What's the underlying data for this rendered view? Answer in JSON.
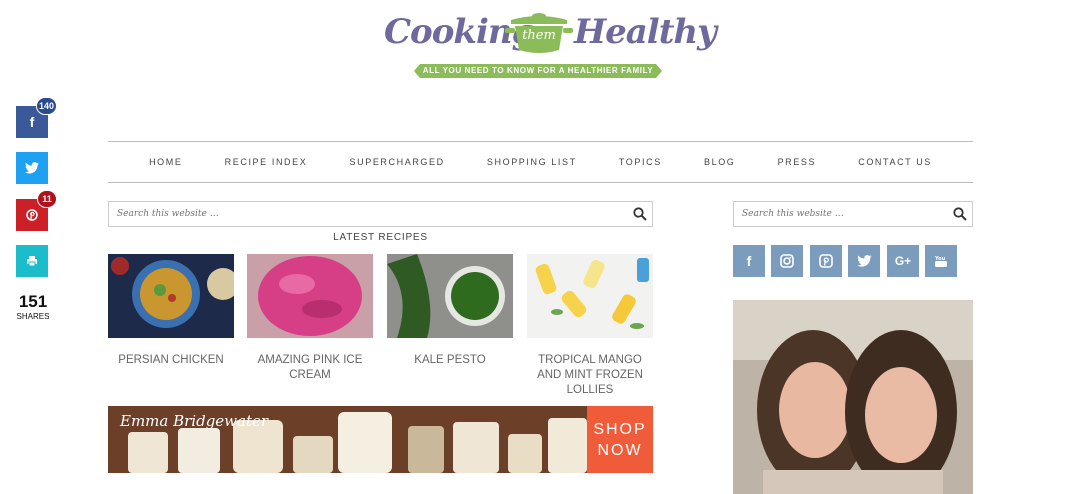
{
  "logo": {
    "left": "Cooking",
    "middle": "them",
    "right": "Healthy",
    "tagline": "ALL YOU NEED TO KNOW FOR A HEALTHIER FAMILY"
  },
  "share": {
    "facebook_count": "140",
    "pinterest_count": "11",
    "total": "151",
    "total_label": "SHARES"
  },
  "nav": [
    "HOME",
    "RECIPE INDEX",
    "SUPERCHARGED",
    "SHOPPING LIST",
    "TOPICS",
    "BLOG",
    "PRESS",
    "CONTACT US"
  ],
  "search": {
    "placeholder": "Search this website …"
  },
  "latest_heading": "LATEST RECIPES",
  "recipes": [
    {
      "title": "PERSIAN CHICKEN"
    },
    {
      "title": "AMAZING PINK ICE CREAM"
    },
    {
      "title": "KALE PESTO"
    },
    {
      "title": "TROPICAL MANGO AND MINT FROZEN LOLLIES"
    }
  ],
  "ad": {
    "brand": "Emma Bridgewater",
    "shop_line1": "SHOP",
    "shop_line2": "NOW"
  },
  "follow_icons": [
    "facebook-icon",
    "instagram-icon",
    "pinterest-icon",
    "twitter-icon",
    "google-plus-icon",
    "youtube-icon"
  ],
  "colors": {
    "brand_purple": "#6f6a9e",
    "brand_green": "#8cbc5a",
    "follow_blue": "#7b9cbc",
    "shop_orange": "#f05c3a"
  }
}
